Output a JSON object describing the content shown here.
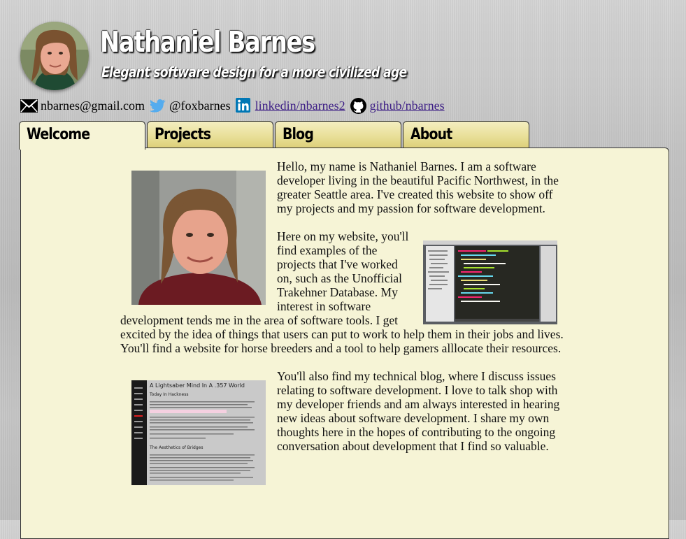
{
  "header": {
    "title": "Nathaniel Barnes",
    "tagline": "Elegant software design for a more civilized age"
  },
  "contact": {
    "email": "nbarnes@gmail.com",
    "twitter": "@foxbarnes",
    "linkedin": "linkedin/nbarnes2",
    "github": "github/nbarnes"
  },
  "tabs": [
    {
      "label": "Welcome",
      "active": true
    },
    {
      "label": "Projects",
      "active": false
    },
    {
      "label": "Blog",
      "active": false
    },
    {
      "label": "About",
      "active": false
    }
  ],
  "welcome": {
    "intro": "Hello, my name is Nathaniel Barnes. I am a software developer living in the beautiful Pacific Northwest, in the greater Seattle area. I've created this website to show off my projects and my passion for software development.",
    "projects": "Here on my website, you'll find examples of the projects that I've worked on, such as the Unofficial Trakehner Database. My interest in software development tends me in the area of software tools. I get excited by the idea of things that users can put to work to help them in their jobs and lives. You'll find a website for horse breeders and a tool to help gamers alllocate their resources.",
    "blog": "You'll also find my technical blog, where I discuss issues relating to software development. I love to talk shop with my developer friends and am always interested in hearing new ideas about software development. I share my own thoughts here in the hopes of contributing to the ongoing conversation about development that I find so valuable."
  },
  "blog_screenshot": {
    "title": "A Lightsaber Mind In A .357 World",
    "post1": "Today In Hackness",
    "post2": "The Aesthetics of Bridges"
  },
  "colors": {
    "tab_gradient": "#e9e09a",
    "panel_bg": "#f6f4d6",
    "link": "#3e1f86",
    "twitter_blue": "#55acee",
    "linkedin_blue": "#0077b5"
  }
}
